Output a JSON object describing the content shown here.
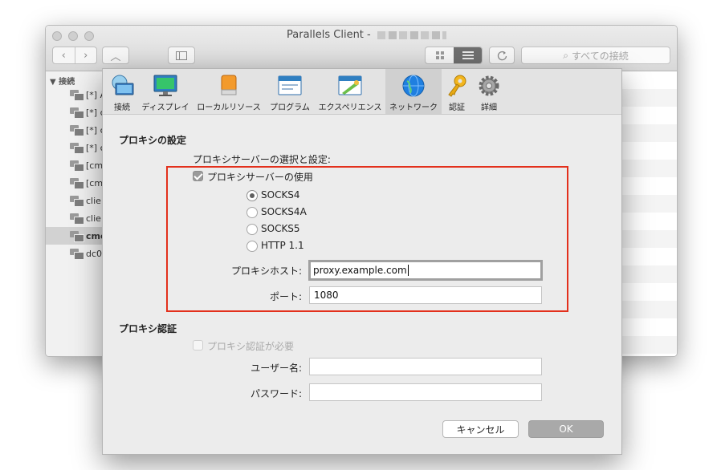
{
  "window": {
    "title": "Parallels Client - ",
    "nav_back": "‹",
    "nav_forward": "›",
    "nav_up": "︿",
    "search_icon": "⌕",
    "search_placeholder": "すべての接続"
  },
  "sidebar": {
    "header": "▼ 接続",
    "items": [
      {
        "label": "[*] A"
      },
      {
        "label": "[*] c"
      },
      {
        "label": "[*] c"
      },
      {
        "label": "[*] c"
      },
      {
        "label": "[cm"
      },
      {
        "label": "[cm"
      },
      {
        "label": "clie"
      },
      {
        "label": "clie"
      },
      {
        "label": "cmc",
        "selected": true
      },
      {
        "label": "dc0"
      }
    ]
  },
  "dialog": {
    "toolbar": [
      {
        "label": "接続",
        "icon": "connection-icon"
      },
      {
        "label": "ディスプレイ",
        "icon": "display-icon"
      },
      {
        "label": "ローカルリソース",
        "icon": "local-resources-icon"
      },
      {
        "label": "プログラム",
        "icon": "program-icon"
      },
      {
        "label": "エクスペリエンス",
        "icon": "experience-icon"
      },
      {
        "label": "ネットワーク",
        "icon": "network-globe-icon",
        "active": true
      },
      {
        "label": "認証",
        "icon": "key-icon"
      },
      {
        "label": "詳細",
        "icon": "gear-icon"
      }
    ],
    "proxy_section_title": "プロキシの設定",
    "proxy_select_label": "プロキシサーバーの選択と設定:",
    "use_proxy_label": "プロキシサーバーの使用",
    "use_proxy_checked": true,
    "proxy_types": [
      {
        "label": "SOCKS4",
        "selected": true
      },
      {
        "label": "SOCKS4A",
        "selected": false
      },
      {
        "label": "SOCKS5",
        "selected": false
      },
      {
        "label": "HTTP 1.1",
        "selected": false
      }
    ],
    "proxy_host_label": "プロキシホスト:",
    "proxy_host_value": "proxy.example.com",
    "port_label": "ポート:",
    "port_value": "1080",
    "auth_section_title": "プロキシ認証",
    "auth_required_label": "プロキシ認証が必要",
    "auth_required_checked": false,
    "username_label": "ユーザー名:",
    "username_value": "",
    "password_label": "パスワード:",
    "password_value": "",
    "cancel_label": "キャンセル",
    "ok_label": "OK"
  },
  "colors": {
    "highlight_border": "#e3301c",
    "ok_button": "#a9a9a9"
  }
}
